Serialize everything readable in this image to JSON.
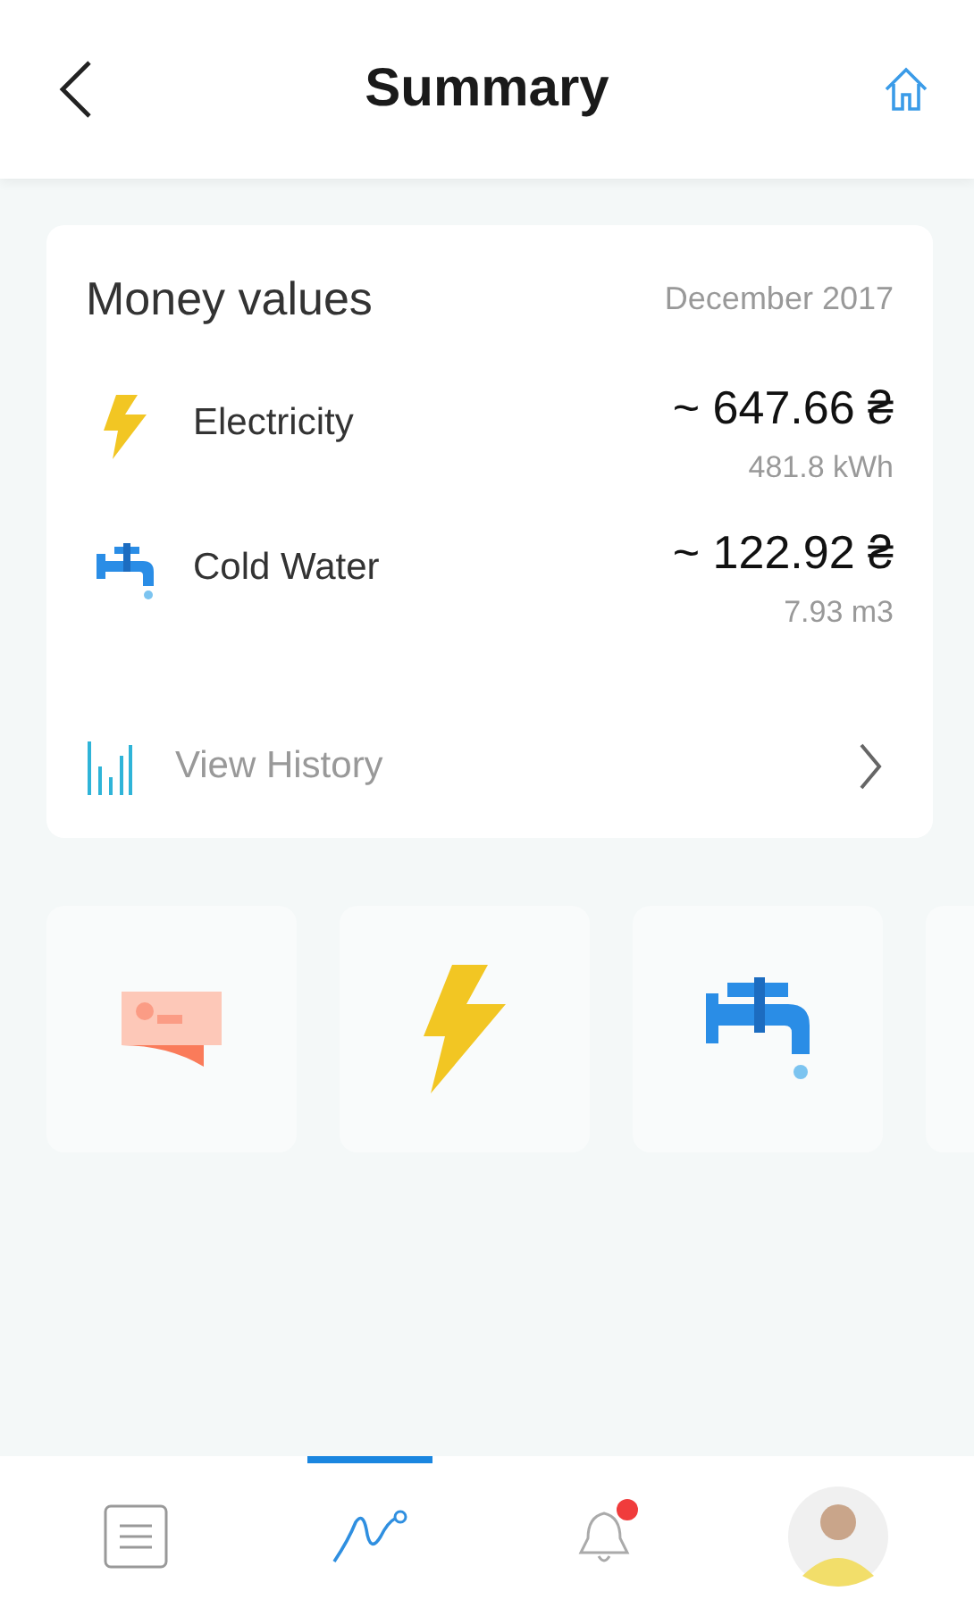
{
  "header": {
    "title": "Summary"
  },
  "card": {
    "title": "Money values",
    "period": "December 2017",
    "items": [
      {
        "kind": "electricity",
        "name": "Electricity",
        "amount": "~ 647.66 ₴",
        "usage": "481.8 kWh"
      },
      {
        "kind": "water",
        "name": "Cold Water",
        "amount": "~ 122.92 ₴",
        "usage": "7.93 m3"
      }
    ],
    "history_link": "View History"
  },
  "tiles": [
    {
      "kind": "money"
    },
    {
      "kind": "electricity"
    },
    {
      "kind": "water"
    },
    {
      "kind": "blank"
    }
  ],
  "tabs": [
    {
      "kind": "list",
      "selected": false,
      "badge": false
    },
    {
      "kind": "chart",
      "selected": true,
      "badge": false
    },
    {
      "kind": "bell",
      "selected": false,
      "badge": true
    },
    {
      "kind": "avatar",
      "selected": false,
      "badge": false
    }
  ]
}
